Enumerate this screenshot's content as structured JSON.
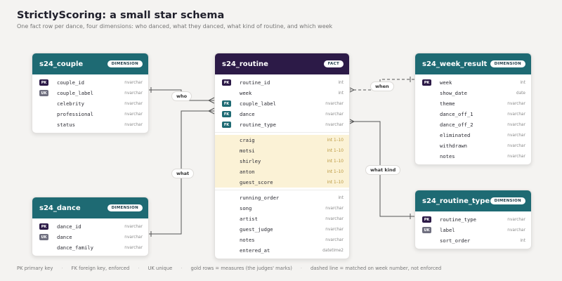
{
  "title": "StrictlyScoring: a small star schema",
  "subtitle": "One fact row per dance, four dimensions: who danced, what they danced, what kind of routine, and which week",
  "tables": {
    "couple": {
      "name": "s24_couple",
      "badge": "DIMENSION",
      "columns": [
        {
          "key": "PK",
          "name": "couple_id",
          "type": "nvarchar"
        },
        {
          "key": "UK",
          "name": "couple_label",
          "type": "nvarchar"
        },
        {
          "key": "",
          "name": "celebrity",
          "type": "nvarchar"
        },
        {
          "key": "",
          "name": "professional",
          "type": "nvarchar"
        },
        {
          "key": "",
          "name": "status",
          "type": "nvarchar"
        }
      ]
    },
    "dance": {
      "name": "s24_dance",
      "badge": "DIMENSION",
      "columns": [
        {
          "key": "PK",
          "name": "dance_id",
          "type": "nvarchar"
        },
        {
          "key": "UK",
          "name": "dance",
          "type": "nvarchar"
        },
        {
          "key": "",
          "name": "dance_family",
          "type": "nvarchar"
        }
      ]
    },
    "routine": {
      "name": "s24_routine",
      "badge": "FACT",
      "keys": [
        {
          "key": "PK",
          "name": "routine_id",
          "type": "int"
        },
        {
          "key": "",
          "name": "week",
          "type": "int"
        },
        {
          "key": "FK",
          "name": "couple_label",
          "type": "nvarchar"
        },
        {
          "key": "FK",
          "name": "dance",
          "type": "nvarchar"
        },
        {
          "key": "FK",
          "name": "routine_type",
          "type": "nvarchar"
        }
      ],
      "measures": [
        {
          "name": "craig",
          "type": "int 1–10"
        },
        {
          "name": "motsi",
          "type": "int 1–10"
        },
        {
          "name": "shirley",
          "type": "int 1–10"
        },
        {
          "name": "anton",
          "type": "int 1–10"
        },
        {
          "name": "guest_score",
          "type": "int 1–10"
        }
      ],
      "others": [
        {
          "name": "running_order",
          "type": "int"
        },
        {
          "name": "song",
          "type": "nvarchar"
        },
        {
          "name": "artist",
          "type": "nvarchar"
        },
        {
          "name": "guest_judge",
          "type": "nvarchar"
        },
        {
          "name": "notes",
          "type": "nvarchar"
        },
        {
          "name": "entered_at",
          "type": "datetime2"
        }
      ]
    },
    "week_result": {
      "name": "s24_week_result",
      "badge": "DIMENSION",
      "columns": [
        {
          "key": "PK",
          "name": "week",
          "type": "int"
        },
        {
          "key": "",
          "name": "show_date",
          "type": "date"
        },
        {
          "key": "",
          "name": "theme",
          "type": "nvarchar"
        },
        {
          "key": "",
          "name": "dance_off_1",
          "type": "nvarchar"
        },
        {
          "key": "",
          "name": "dance_off_2",
          "type": "nvarchar"
        },
        {
          "key": "",
          "name": "eliminated",
          "type": "nvarchar"
        },
        {
          "key": "",
          "name": "withdrawn",
          "type": "nvarchar"
        },
        {
          "key": "",
          "name": "notes",
          "type": "nvarchar"
        }
      ]
    },
    "routine_type": {
      "name": "s24_routine_type",
      "badge": "DIMENSION",
      "columns": [
        {
          "key": "PK",
          "name": "routine_type",
          "type": "nvarchar"
        },
        {
          "key": "UK",
          "name": "label",
          "type": "nvarchar"
        },
        {
          "key": "",
          "name": "sort_order",
          "type": "int"
        }
      ]
    }
  },
  "relationships": {
    "who": "who",
    "what": "what",
    "what_kind": "what kind",
    "when": "when"
  },
  "legend": [
    "PK primary key",
    "FK foreign key, enforced",
    "UK unique",
    "gold rows = measures (the judges' marks)",
    "dashed line = matched on week number, not enforced"
  ],
  "colors": {
    "dimension_header": "#1e6a73",
    "fact_header": "#2c1a47",
    "measure_row": "#fbf2d6",
    "background": "#f4f3f1"
  }
}
